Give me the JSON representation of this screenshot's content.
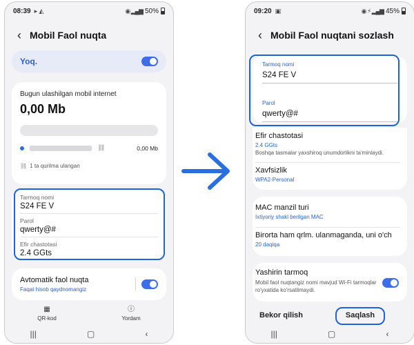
{
  "left_screen": {
    "status": {
      "time": "08:39",
      "icons": "▸ ◭",
      "battery": "50%"
    },
    "title": "Mobil Faol nuqta",
    "toggle_label": "Yoq.",
    "usage_title": "Bugun ulashilgan mobil internet",
    "usage_value": "0,00 Mb",
    "device_usage": "0,00 Mb",
    "connected_count": "1 ta qurilma ulangan",
    "network_name_label": "Tarmoq nomi",
    "network_name_value": "S24 FE V",
    "password_label": "Parol",
    "password_value": "qwerty@#",
    "band_label": "Efir chastotasi",
    "band_value": "2.4 GGts",
    "auto_title": "Avtomatik faol nuqta",
    "auto_sub": "Faqat hisob qaydnomangiz",
    "qr_label": "QR-kod",
    "help_label": "Yordam"
  },
  "right_screen": {
    "status": {
      "time": "09:20",
      "icons": "▣",
      "battery": "45%"
    },
    "title": "Mobil Faol nuqtani sozlash",
    "network_name_label": "Tarmoq nomi",
    "network_name_value": "S24 FE V",
    "password_label": "Parol",
    "password_value": "qwerty@#",
    "band_title": "Efir chastotasi",
    "band_value": "2.4 GGts",
    "band_desc": "Boshqa tasmalar yaxshiroq unumdorlikni ta'minlaydi.",
    "security_title": "Xavfsizlik",
    "security_value": "WPA2-Personal",
    "mac_title": "MAC manzil turi",
    "mac_value": "Ixtiyoriy shakl berilgan MAC",
    "timeout_title": "Birorta ham qrlm. ulanmaganda, uni o'ch",
    "timeout_value": "20 daqiqa",
    "hidden_title": "Yashirin tarmoq",
    "hidden_desc": "Mobil faol nuqtangiz nomi mavjud Wi-Fi tarmoqlar ro'yxatida ko'rsatilmaydi.",
    "cancel_label": "Bekor qilish",
    "save_label": "Saqlash"
  },
  "colors": {
    "accent": "#1a63d8",
    "toggle": "#3d6ee8",
    "arrow": "#2a6fe0"
  }
}
